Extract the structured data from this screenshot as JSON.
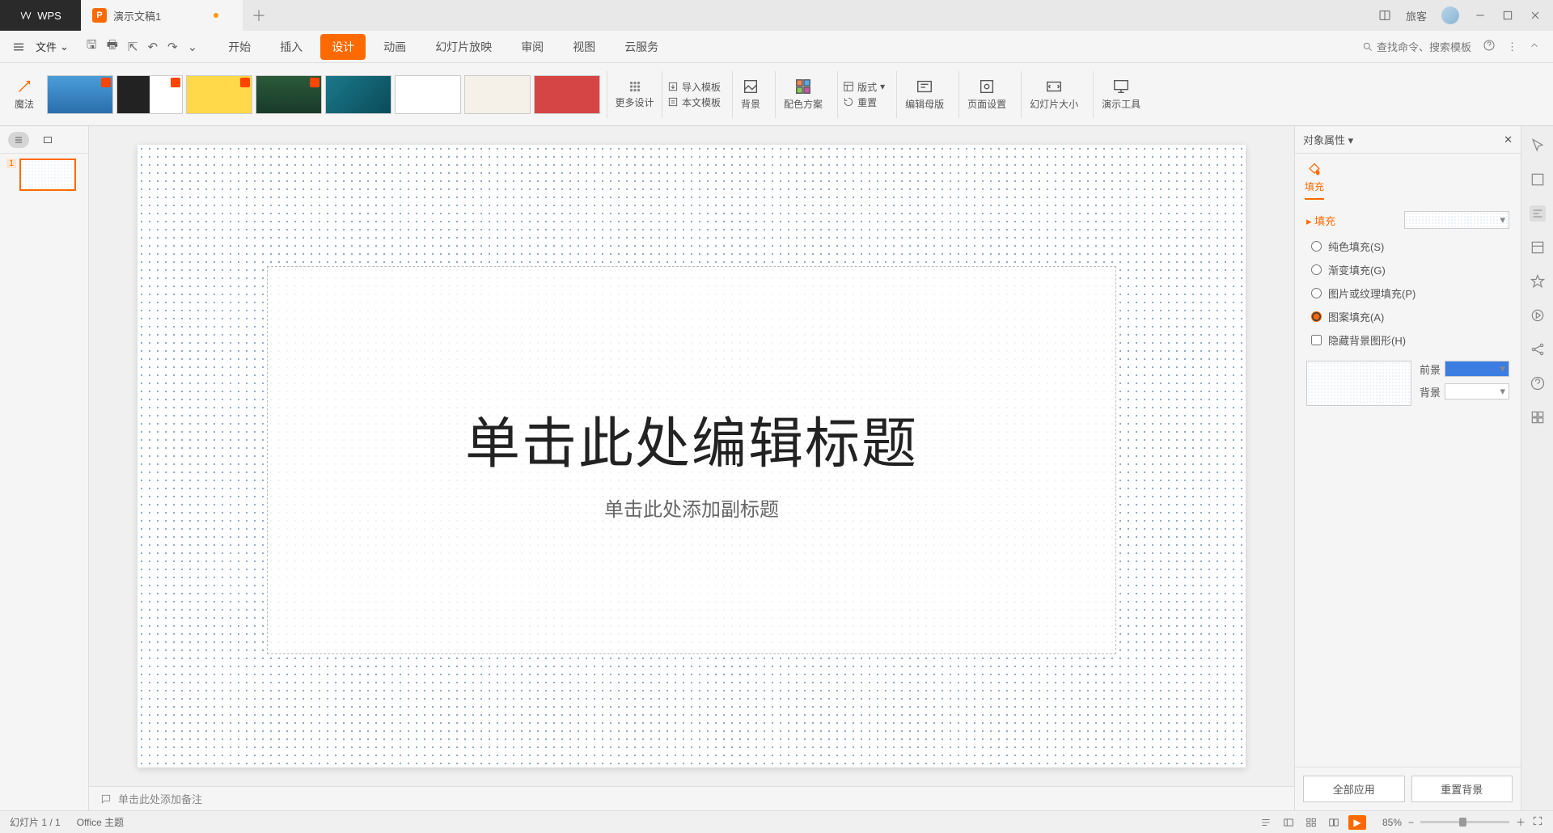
{
  "titlebar": {
    "appname": "WPS",
    "doc_tab": "演示文稿1",
    "user": "旅客"
  },
  "menubar": {
    "file": "文件",
    "tabs": [
      "开始",
      "插入",
      "设计",
      "动画",
      "幻灯片放映",
      "审阅",
      "视图",
      "云服务"
    ],
    "active": 2,
    "search_placeholder": "查找命令、搜索模板"
  },
  "ribbon": {
    "magic": "魔法",
    "more_design": "更多设计",
    "import_template": "导入模板",
    "this_template": "本文模板",
    "background": "背景",
    "color_scheme": "配色方案",
    "layout": "版式",
    "reset": "重置",
    "edit_master": "编辑母版",
    "page_setup": "页面设置",
    "slide_size": "幻灯片大小",
    "presentation_tool": "演示工具"
  },
  "slide": {
    "title_placeholder": "单击此处编辑标题",
    "subtitle_placeholder": "单击此处添加副标题",
    "notes_placeholder": "单击此处添加备注"
  },
  "panel": {
    "title": "对象属性",
    "tab_fill": "填充",
    "section_fill": "填充",
    "radio_solid": "纯色填充(S)",
    "radio_gradient": "渐变填充(G)",
    "radio_picture": "图片或纹理填充(P)",
    "radio_pattern": "图案填充(A)",
    "check_hide_bg": "隐藏背景图形(H)",
    "foreground": "前景",
    "background": "背景",
    "apply_all": "全部应用",
    "reset_bg": "重置背景"
  },
  "status": {
    "slide_count": "幻灯片 1 / 1",
    "theme": "Office 主题",
    "zoom": "85%"
  }
}
